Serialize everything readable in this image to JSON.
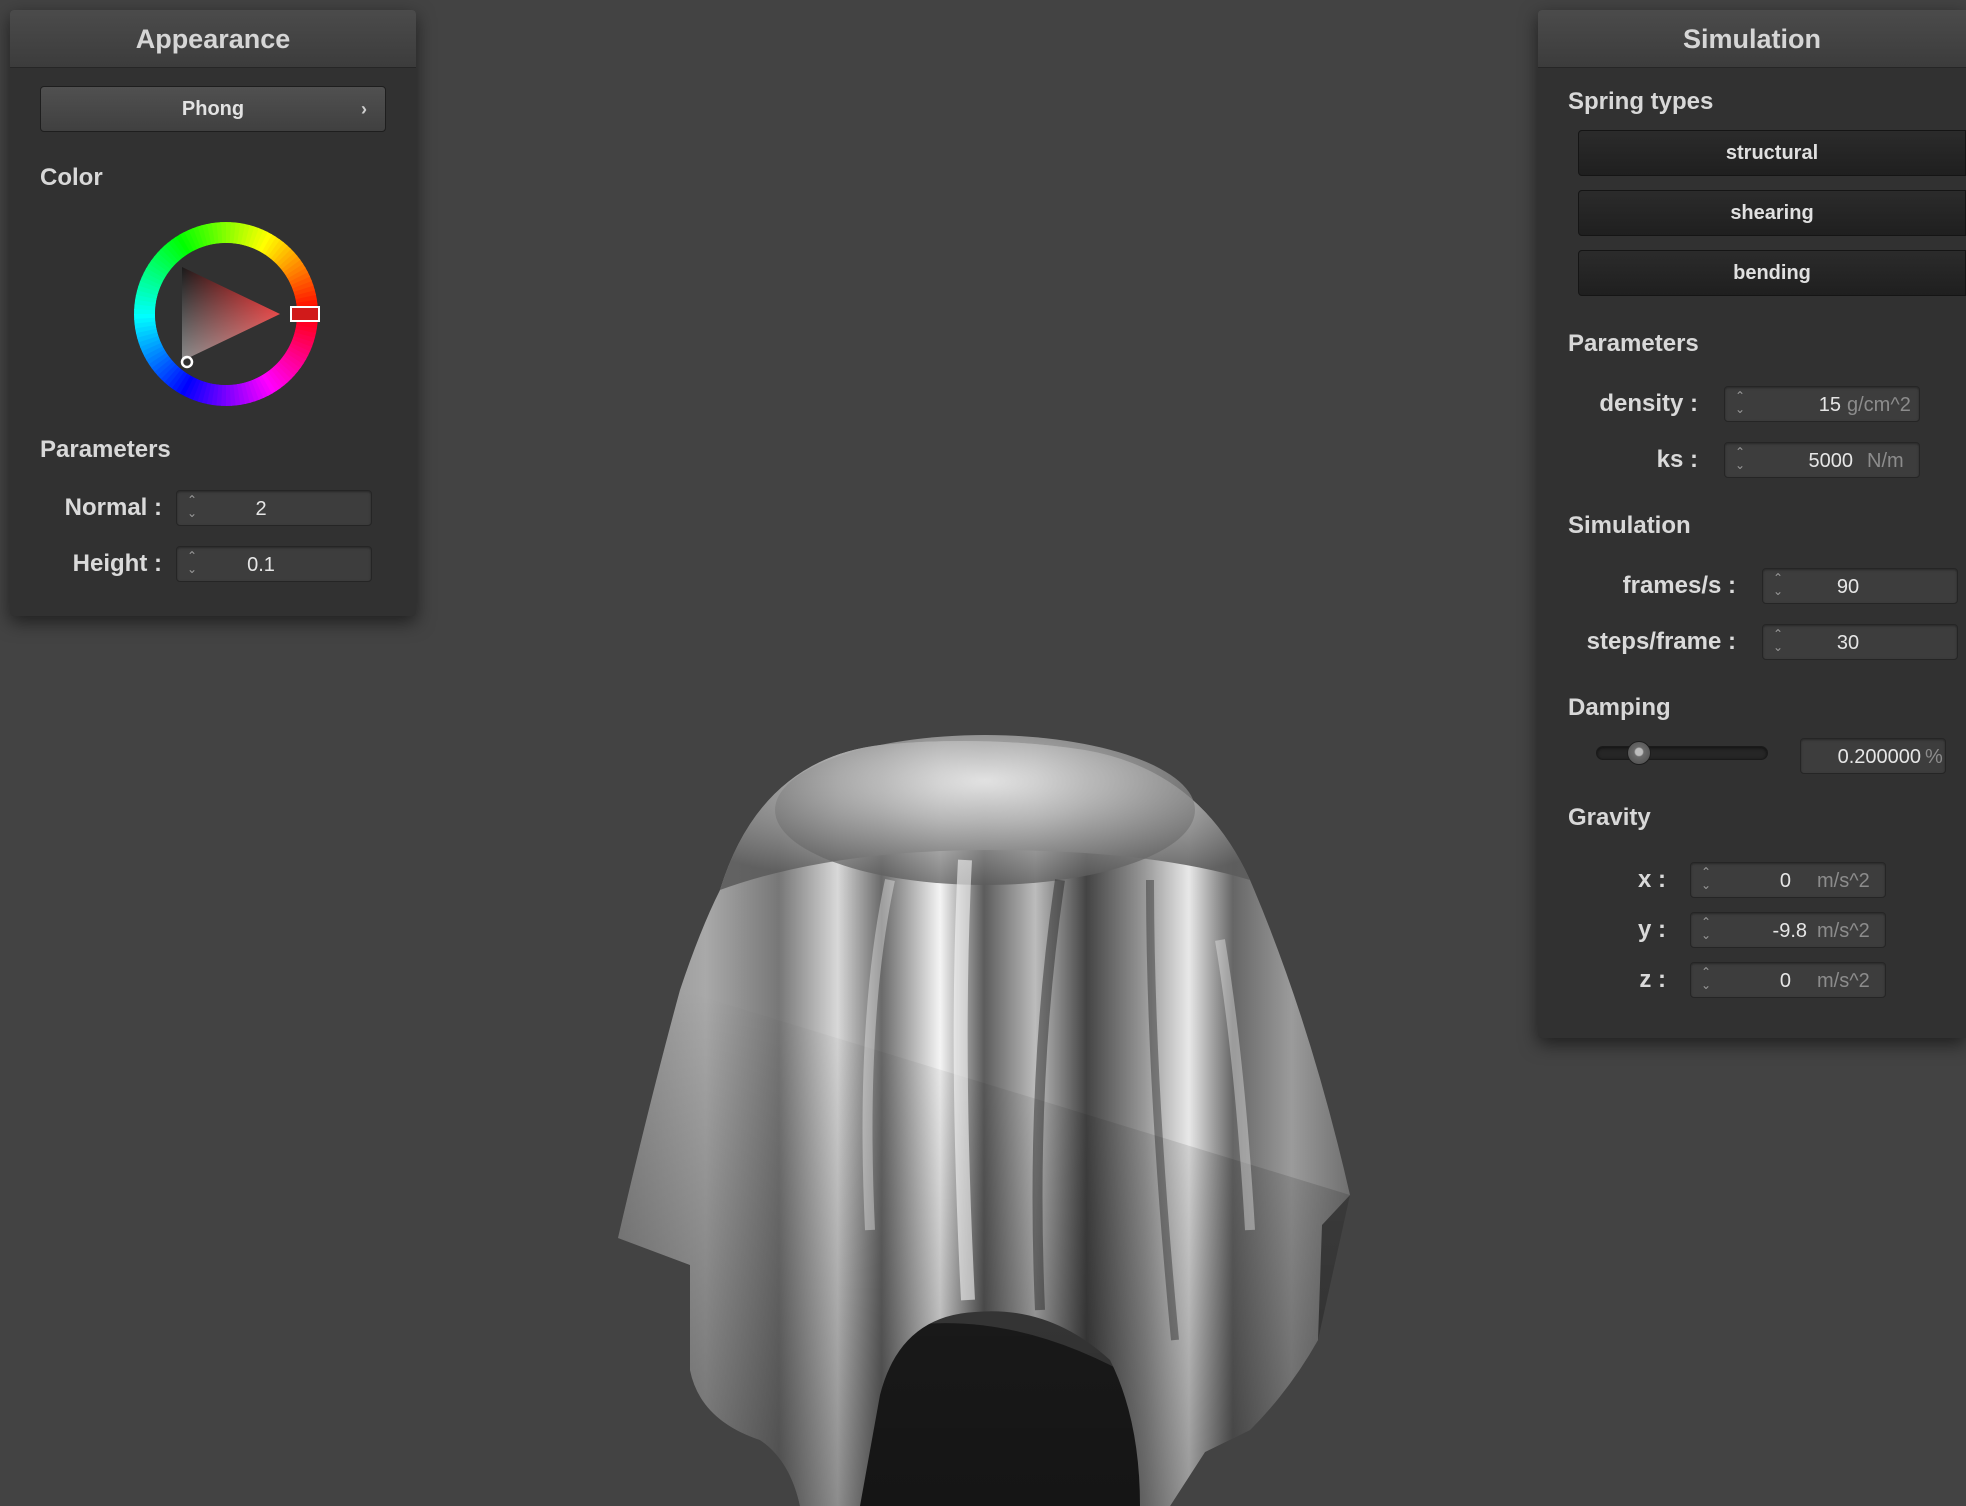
{
  "appearance": {
    "title": "Appearance",
    "shader": "Phong",
    "color_label": "Color",
    "selected_color": "#d11a1a",
    "parameters_label": "Parameters",
    "normal": {
      "label": "Normal :",
      "value": "2"
    },
    "height": {
      "label": "Height :",
      "value": "0.1"
    }
  },
  "simulation": {
    "title": "Simulation",
    "spring_types_label": "Spring types",
    "spring_types": [
      "structural",
      "shearing",
      "bending"
    ],
    "parameters_label": "Parameters",
    "density": {
      "label": "density :",
      "value": "15",
      "unit": "g/cm^2"
    },
    "ks": {
      "label": "ks :",
      "value": "5000",
      "unit": "N/m"
    },
    "simulation_label": "Simulation",
    "frames": {
      "label": "frames/s :",
      "value": "90"
    },
    "steps": {
      "label": "steps/frame :",
      "value": "30"
    },
    "damping_label": "Damping",
    "damping": {
      "value": "0.200000",
      "unit": "%",
      "slider_fraction": 0.2
    },
    "gravity_label": "Gravity",
    "gravity": [
      {
        "label": "x :",
        "value": "0",
        "unit": "m/s^2"
      },
      {
        "label": "y :",
        "value": "-9.8",
        "unit": "m/s^2"
      },
      {
        "label": "z :",
        "value": "0",
        "unit": "m/s^2"
      }
    ]
  },
  "colors": {
    "background": "#434343",
    "panel": "#313131",
    "cloth": "#a8a8a8"
  },
  "icons": {
    "spinner": "up-down-arrows-icon",
    "combo": "chevron-right-icon"
  }
}
